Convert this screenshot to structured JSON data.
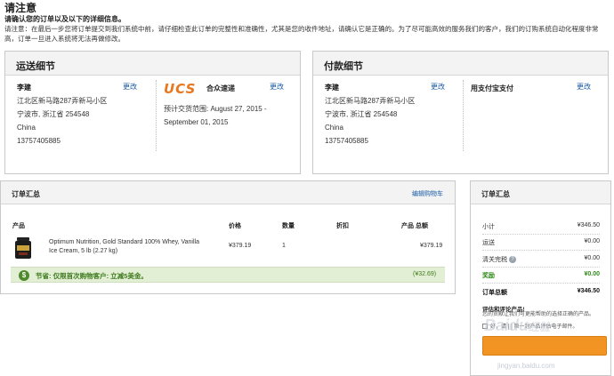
{
  "notice": {
    "title": "请注意",
    "subtitle": "请确认您的订单以及以下的详细信息。",
    "body": "请注意：在最后一步您将订单提交到我们系统中前，请仔细检查此订单的完整性和准确性，尤其是您的收件地址，请确认它是正确的。为了尽可能高效的服务我们的客户，我们的订购系统自动化程度非常高，订单一旦进入系统将无法再做修改。"
  },
  "shipping": {
    "title": "运送细节",
    "edit": "更改",
    "address": {
      "name": "李建",
      "line1": "江北区新马路287弄新马小区",
      "line2": "宁波市, 浙江省 254548",
      "country": "China",
      "phone": "13757405885"
    },
    "carrier": {
      "logo_text": "UCS",
      "name": "合众速递",
      "edit": "更改",
      "estimate_label": "预计交货范围: August 27, 2015 -",
      "estimate_end": "September 01, 2015"
    }
  },
  "payment": {
    "title": "付款细节",
    "edit": "更改",
    "address": {
      "name": "李建",
      "line1": "江北区新马路287弄新马小区",
      "line2": "宁波市, 浙江省 254548",
      "country": "China",
      "phone": "13757405885"
    },
    "method": "用支付宝支付",
    "method_edit": "更改"
  },
  "order_summary": {
    "title": "订单汇总",
    "edit_cart": "编辑购物车",
    "headers": {
      "product": "产品",
      "price": "价格",
      "qty": "数量",
      "discount": "折扣",
      "total": "产品 总额"
    },
    "item": {
      "name_line1": "Optimum Nutrition, Gold Standard 100% Whey, Vanilla",
      "name_line2": "Ice Cream, 5 lb (2.27 kg)",
      "price": "¥379.19",
      "qty": "1",
      "discount": "",
      "total": "¥379.19"
    },
    "savings": {
      "icon": "$",
      "label": "节省: 仅限首次购物客户: 立减5美金。",
      "amount": "(¥32.69)"
    }
  },
  "side_summary": {
    "title": "订单汇总",
    "rows": [
      {
        "label": "小计",
        "value": "¥346.50"
      },
      {
        "label": "运送",
        "value": "¥0.00"
      },
      {
        "label": "清关完税",
        "value": "¥0.00"
      }
    ],
    "reward": {
      "label": "奖励",
      "value": "¥0.00"
    },
    "total": {
      "label": "订单总额",
      "value": "¥346.50"
    },
    "review_title": "评估和评论产品!",
    "review_text": "您的贡献让我们可更能帮助的选择正确的产品。",
    "review_check": "好，请 [ ] 第一封产品评估电子邮件。",
    "accent_color": "#f29423"
  },
  "watermark": {
    "brand": "Baidu",
    "suffix": "经验",
    "url": "jingyan.baidu.com"
  },
  "colors": {
    "link": "#1a5aa6",
    "panel_header": "#f3f3f3",
    "savings_bg": "#e3efd4",
    "savings_text": "#3d7a1e",
    "reward_green": "#2f8a1a",
    "ucs_orange": "#e9771e"
  }
}
